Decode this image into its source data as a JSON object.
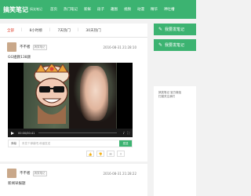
{
  "nav": {
    "logo": "搞笑笔记",
    "logo_sub": "搞笑笔记",
    "items": [
      "首页",
      "热门笔记",
      "新鲜",
      "段子",
      "趣图",
      "视频",
      "动漫",
      "精华",
      "神吐槽",
      "囧图"
    ]
  },
  "tabs": {
    "items": [
      "全部",
      "8小时榜",
      "7天热门",
      "30天热门"
    ]
  },
  "posts": [
    {
      "author": "不不者",
      "author_tag": "搞笑笔记",
      "time": "2016-08-31 21:28:10",
      "text": "GG姐教138颜",
      "video": {
        "time": "00:00/00:41",
        "progress": 0
      },
      "danmu_toggle": "弹幕",
      "danmu_placeholder": "来发个弹幕吧,和谐发送",
      "danmu_send": "发送"
    },
    {
      "author": "不不者",
      "author_tag": "搞笑笔记",
      "time": "2016-08-31 21:28:22",
      "text": "新闻早报题"
    }
  ],
  "sidebar": {
    "btn_publish": "我要发笔记",
    "btn_submit": "我要发笔记",
    "note_line1": "搞笑笔记 官方微信",
    "note_line2": "扫描关注我们"
  },
  "colors": {
    "brand": "#3cb371",
    "active_tab": "#e0412f"
  }
}
